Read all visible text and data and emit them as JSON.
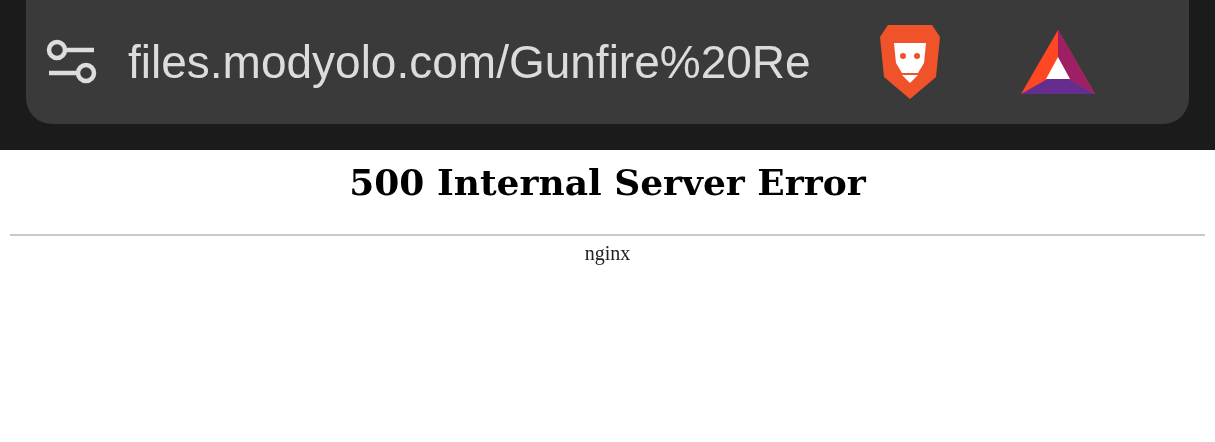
{
  "address_bar": {
    "url": "files.modyolo.com/Gunfire%20Re"
  },
  "page": {
    "heading": "500 Internal Server Error",
    "footer": "nginx"
  }
}
